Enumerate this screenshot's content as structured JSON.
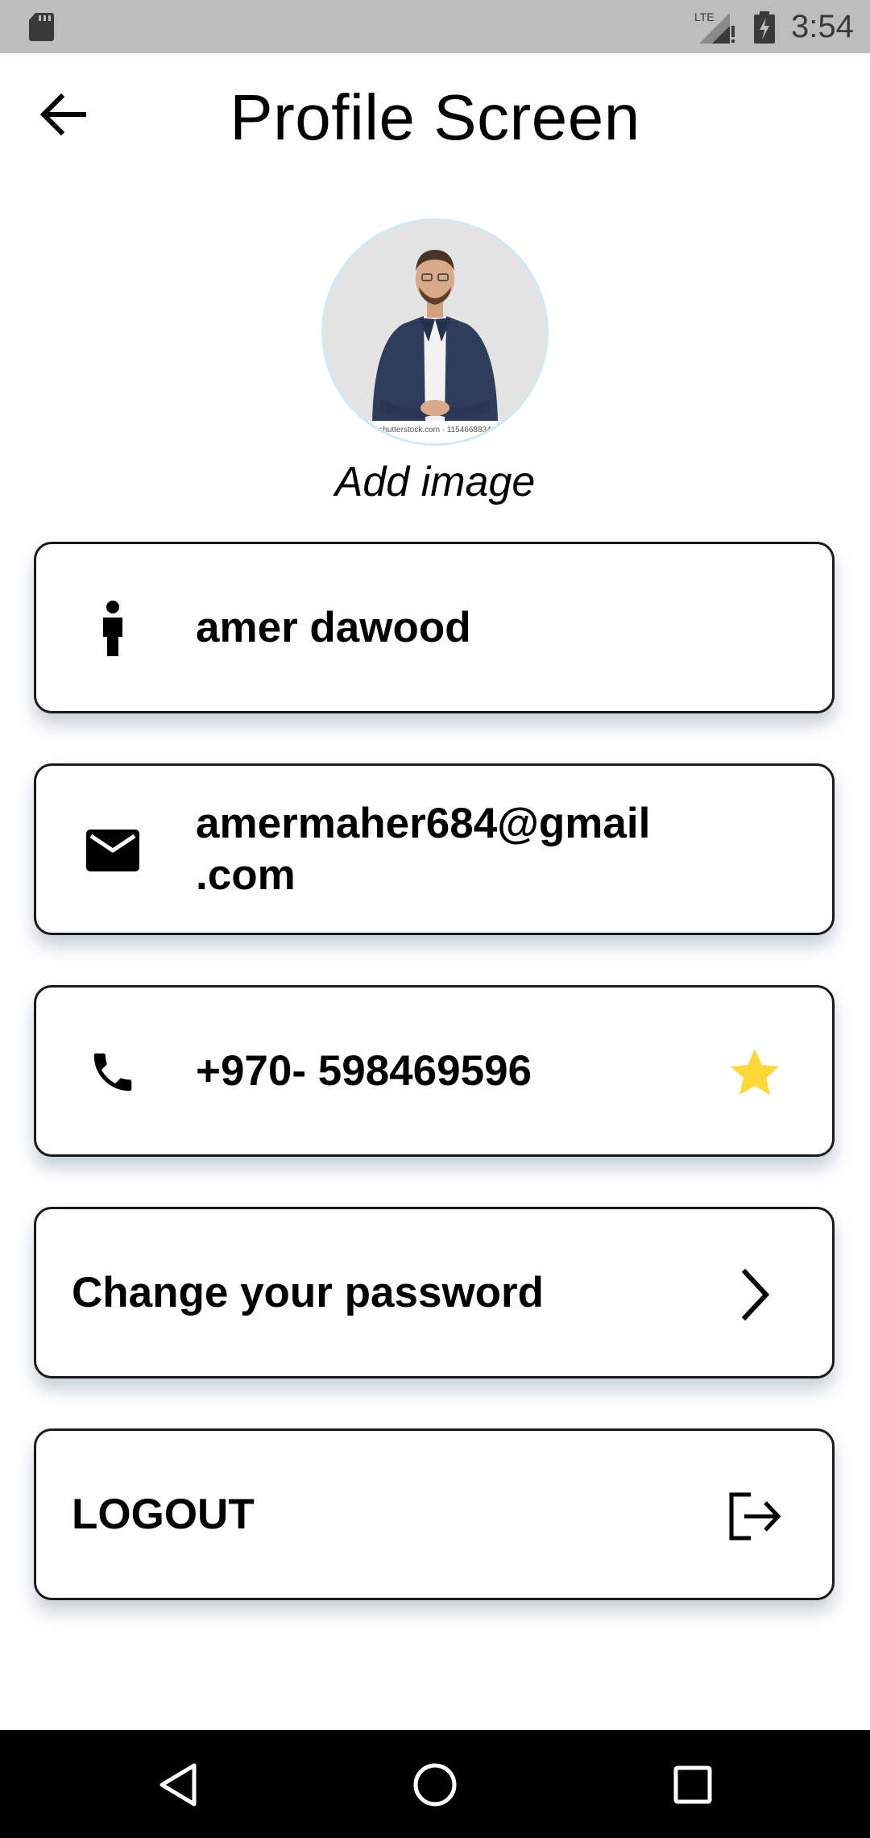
{
  "status_bar": {
    "time": "3:54",
    "network": "LTE",
    "icons": [
      "sd-card-icon",
      "lte-signal-icon",
      "battery-icon"
    ]
  },
  "app_bar": {
    "title": "Profile Screen",
    "back_icon": "arrow-back-icon"
  },
  "avatar": {
    "caption": "Add image",
    "image_watermark": "shutterstock.com · 1154668834"
  },
  "profile": {
    "name": "amer dawood",
    "email_line1": "amermaher684@gmail",
    "email_line2": ".com",
    "phone": "+970- 598469596"
  },
  "actions": {
    "change_password": "Change your password",
    "logout": "LOGOUT"
  },
  "colors": {
    "status_bar": "#bdbdbd",
    "star": "#fdd835",
    "card_border": "#1a1a1a",
    "nav_bar": "#000000"
  },
  "nav": {
    "icons": [
      "nav-back-icon",
      "nav-home-icon",
      "nav-recents-icon"
    ]
  }
}
